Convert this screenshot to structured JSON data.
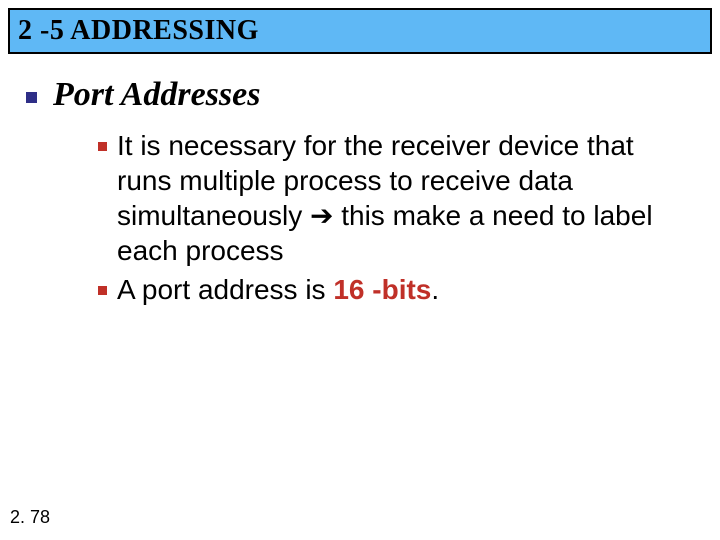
{
  "title": "2 -5   ADDRESSING",
  "heading": "Port  Addresses",
  "bullets": {
    "b1": "It is necessary for the receiver device that runs multiple process to receive data simultaneously ",
    "b1_arrow": "➔",
    "b1_tail": " this make a need to label each process",
    "b2_lead": "A port address is ",
    "b2_bits": "16 -bits",
    "b2_period": "."
  },
  "page": "2. 78"
}
